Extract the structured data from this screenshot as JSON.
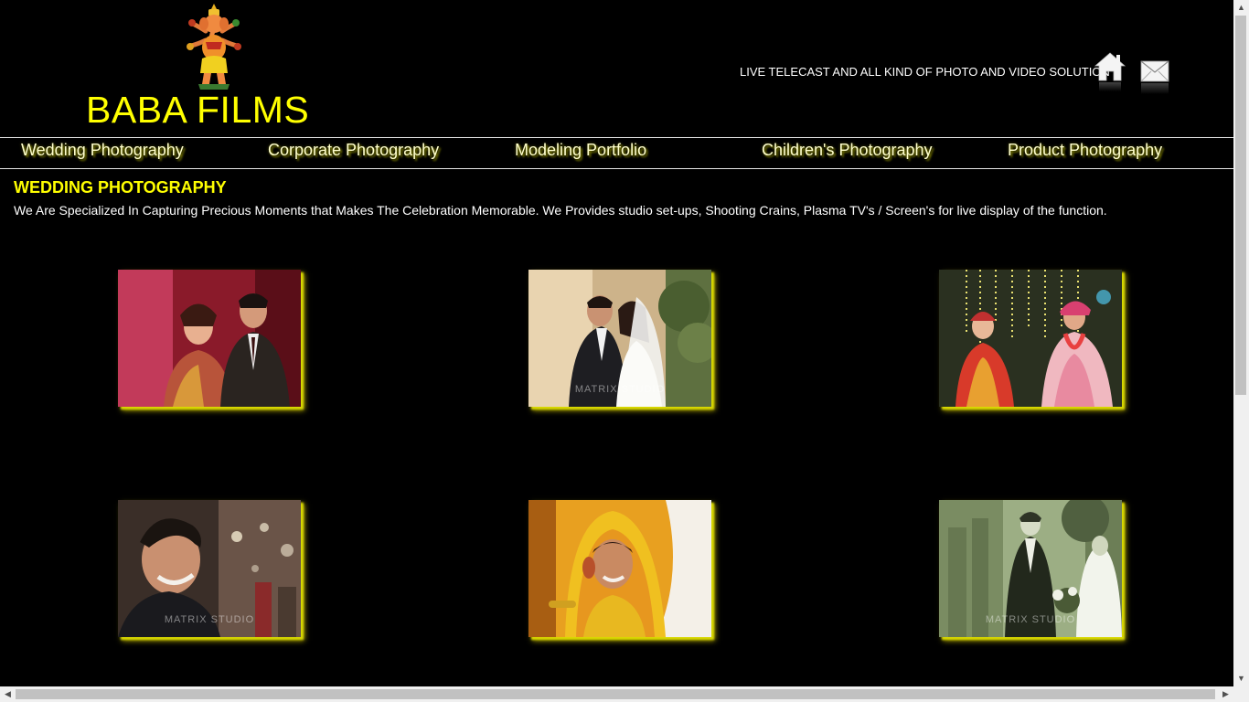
{
  "header": {
    "brand_title": "BABA FILMS",
    "tagline": "LIVE TELECAST AND ALL KIND OF PHOTO AND VIDEO SOLUTION",
    "logo_icon": "ganesha-icon",
    "home_icon": "home-icon",
    "mail_icon": "mail-icon"
  },
  "nav": {
    "items": [
      {
        "label": "Wedding Photography"
      },
      {
        "label": "Corporate Photography"
      },
      {
        "label": "Modeling Portfolio"
      },
      {
        "label": "Children's Photography"
      },
      {
        "label": "Product Photography"
      }
    ]
  },
  "main": {
    "title": "WEDDING PHOTOGRAPHY",
    "description": "We Are Specialized In Capturing Precious Moments that Makes The Celebration Memorable. We Provides studio set-ups, Shooting Crains, Plasma TV's / Screen's for live display of the function.",
    "gallery": [
      {
        "subject": "couple-portrait-red",
        "watermark": ""
      },
      {
        "subject": "couple-embrace-white-gown",
        "watermark": "MATRIX STUDIO"
      },
      {
        "subject": "wedding-ceremony-lights",
        "watermark": ""
      },
      {
        "subject": "groom-smiling",
        "watermark": "MATRIX STUDIO"
      },
      {
        "subject": "bride-yellow-veil",
        "watermark": ""
      },
      {
        "subject": "couple-green-tone",
        "watermark": "MATRIX STUDIO"
      }
    ]
  },
  "colors": {
    "background": "#000000",
    "accent_yellow": "#ffff00",
    "text_white": "#ffffff",
    "nav_text": "#ffffcc",
    "thumb_shadow": "#d8d800"
  }
}
